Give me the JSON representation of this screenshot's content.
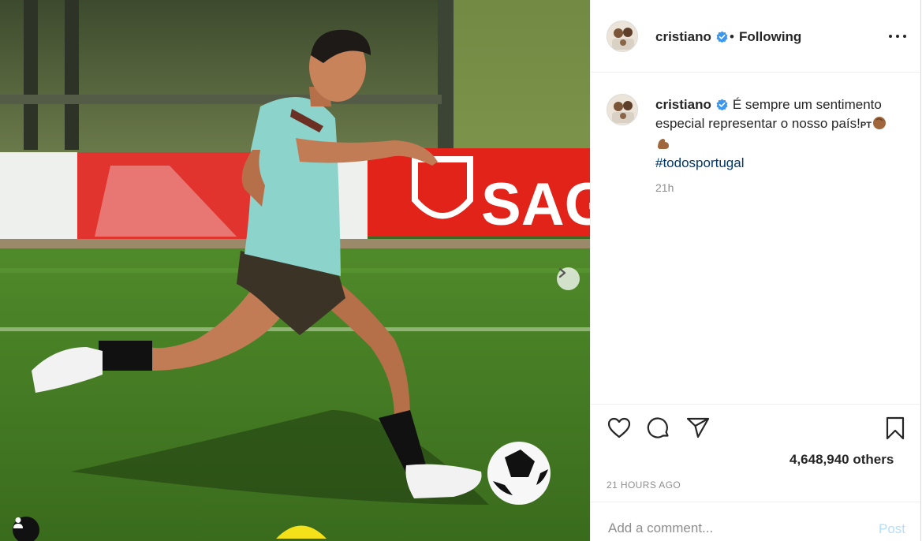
{
  "post": {
    "username": "cristiano",
    "follow_separator": "•",
    "follow_status": "Following",
    "caption_text": "É sempre um sentimento especial representar o nosso país!",
    "caption_suffix": "PT",
    "hashtag": "#todosportugal",
    "comment_time": "21h",
    "likes_text": "4,648,940 others",
    "post_time": "21 HOURS AGO"
  },
  "photo": {
    "banner_text": "SAG"
  },
  "comment_box": {
    "placeholder": "Add a comment...",
    "post_label": "Post"
  },
  "icons": {
    "verified": "verified-badge-icon",
    "more": "more-options-icon",
    "like": "heart-icon",
    "comment": "comment-bubble-icon",
    "share": "paper-plane-icon",
    "save": "bookmark-icon",
    "next": "chevron-right-icon",
    "tagged_user": "user-tag-icon"
  },
  "colors": {
    "verified_blue": "#3897f0",
    "hashtag_blue": "#00376b",
    "post_button": "#b2dffc",
    "muted_text": "#8e8e8e"
  }
}
